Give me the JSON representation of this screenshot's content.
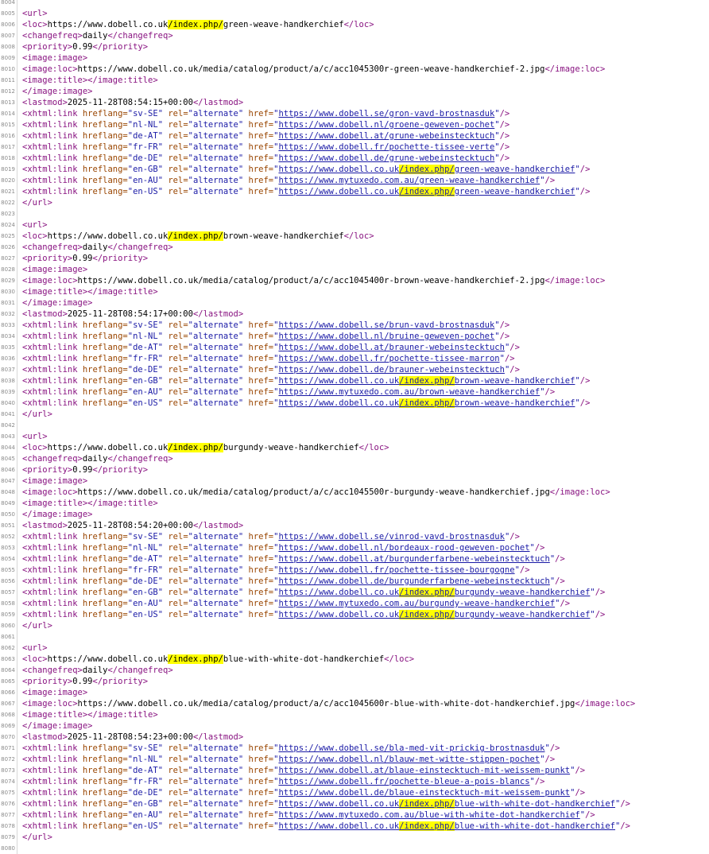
{
  "viewer": {
    "first_line_number": 8004,
    "hl_term": "/index.php/",
    "active_match": "8037"
  },
  "blocks": [
    {
      "loc": "https://www.dobell.co.uk/index.php/green-weave-handkerchief",
      "changefreq": "daily",
      "priority": "0.99",
      "image_loc": "https://www.dobell.co.uk/media/catalog/product/a/c/acc1045300r-green-weave-handkerchief-2.jpg",
      "lastmod": "2025-11-28T08:54:15+00:00",
      "links": [
        {
          "hreflang": "sv-SE",
          "href": "https://www.dobell.se/gron-vavd-brostnasduk"
        },
        {
          "hreflang": "nl-NL",
          "href": "https://www.dobell.nl/groene-geweven-pochet"
        },
        {
          "hreflang": "de-AT",
          "href": "https://www.dobell.at/grune-webeinstecktuch"
        },
        {
          "hreflang": "fr-FR",
          "href": "https://www.dobell.fr/pochette-tissee-verte"
        },
        {
          "hreflang": "de-DE",
          "href": "https://www.dobell.de/grune-webeinstecktuch"
        },
        {
          "hreflang": "en-GB",
          "href": "https://www.dobell.co.uk/index.php/green-weave-handkerchief"
        },
        {
          "hreflang": "en-AU",
          "href": "https://www.mytuxedo.com.au/green-weave-handkerchief"
        },
        {
          "hreflang": "en-US",
          "href": "https://www.dobell.co.uk/index.php/green-weave-handkerchief"
        }
      ]
    },
    {
      "loc": "https://www.dobell.co.uk/index.php/brown-weave-handkerchief",
      "changefreq": "daily",
      "priority": "0.99",
      "image_loc": "https://www.dobell.co.uk/media/catalog/product/a/c/acc1045400r-brown-weave-handkerchief-2.jpg",
      "lastmod": "2025-11-28T08:54:17+00:00",
      "links": [
        {
          "hreflang": "sv-SE",
          "href": "https://www.dobell.se/brun-vavd-brostnasduk"
        },
        {
          "hreflang": "nl-NL",
          "href": "https://www.dobell.nl/bruine-geweven-pochet"
        },
        {
          "hreflang": "de-AT",
          "href": "https://www.dobell.at/brauner-webeinstecktuch"
        },
        {
          "hreflang": "fr-FR",
          "href": "https://www.dobell.fr/pochette-tissee-marron"
        },
        {
          "hreflang": "de-DE",
          "href": "https://www.dobell.de/brauner-webeinstecktuch"
        },
        {
          "hreflang": "en-GB",
          "href": "https://www.dobell.co.uk/index.php/brown-weave-handkerchief"
        },
        {
          "hreflang": "en-AU",
          "href": "https://www.mytuxedo.com.au/brown-weave-handkerchief"
        },
        {
          "hreflang": "en-US",
          "href": "https://www.dobell.co.uk/index.php/brown-weave-handkerchief"
        }
      ]
    },
    {
      "loc": "https://www.dobell.co.uk/index.php/burgundy-weave-handkerchief",
      "changefreq": "daily",
      "priority": "0.99",
      "image_loc": "https://www.dobell.co.uk/media/catalog/product/a/c/acc1045500r-burgundy-weave-handkerchief.jpg",
      "lastmod": "2025-11-28T08:54:20+00:00",
      "links": [
        {
          "hreflang": "sv-SE",
          "href": "https://www.dobell.se/vinrod-vavd-brostnasduk"
        },
        {
          "hreflang": "nl-NL",
          "href": "https://www.dobell.nl/bordeaux-rood-geweven-pochet"
        },
        {
          "hreflang": "de-AT",
          "href": "https://www.dobell.at/burgunderfarbene-webeinstecktuch"
        },
        {
          "hreflang": "fr-FR",
          "href": "https://www.dobell.fr/pochette-tissee-bourgogne"
        },
        {
          "hreflang": "de-DE",
          "href": "https://www.dobell.de/burgunderfarbene-webeinstecktuch"
        },
        {
          "hreflang": "en-GB",
          "href": "https://www.dobell.co.uk/index.php/burgundy-weave-handkerchief"
        },
        {
          "hreflang": "en-AU",
          "href": "https://www.mytuxedo.com.au/burgundy-weave-handkerchief"
        },
        {
          "hreflang": "en-US",
          "href": "https://www.dobell.co.uk/index.php/burgundy-weave-handkerchief"
        }
      ]
    },
    {
      "loc": "https://www.dobell.co.uk/index.php/blue-with-white-dot-handkerchief",
      "changefreq": "daily",
      "priority": "0.99",
      "image_loc": "https://www.dobell.co.uk/media/catalog/product/a/c/acc1045600r-blue-with-white-dot-handkerchief.jpg",
      "lastmod": "2025-11-28T08:54:23+00:00",
      "links": [
        {
          "hreflang": "sv-SE",
          "href": "https://www.dobell.se/bla-med-vit-prickig-brostnasduk"
        },
        {
          "hreflang": "nl-NL",
          "href": "https://www.dobell.nl/blauw-met-witte-stippen-pochet"
        },
        {
          "hreflang": "de-AT",
          "href": "https://www.dobell.at/blaue-einstecktuch-mit-weissem-punkt"
        },
        {
          "hreflang": "fr-FR",
          "href": "https://www.dobell.fr/pochette-bleue-a-pois-blancs"
        },
        {
          "hreflang": "de-DE",
          "href": "https://www.dobell.de/blaue-einstecktuch-mit-weissem-punkt"
        },
        {
          "hreflang": "en-GB",
          "href": "https://www.dobell.co.uk/index.php/blue-with-white-dot-handkerchief"
        },
        {
          "hreflang": "en-AU",
          "href": "https://www.mytuxedo.com.au/blue-with-white-dot-handkerchief"
        },
        {
          "hreflang": "en-US",
          "href": "https://www.dobell.co.uk/index.php/blue-with-white-dot-handkerchief"
        }
      ]
    }
  ]
}
